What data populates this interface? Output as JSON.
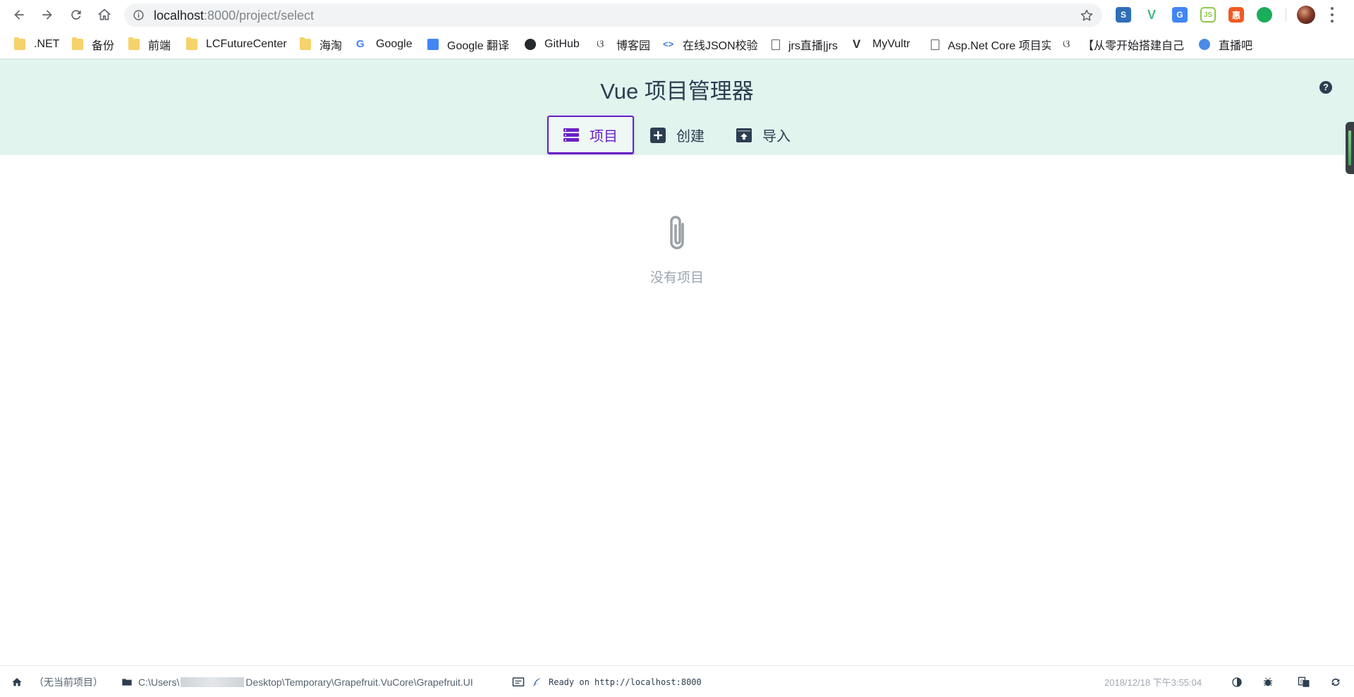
{
  "browser": {
    "url_host": "localhost",
    "url_path": ":8000/project/select",
    "bookmarks": [
      {
        "label": ".NET",
        "icon": "folder-icon"
      },
      {
        "label": "备份",
        "icon": "folder-icon"
      },
      {
        "label": "前端",
        "icon": "folder-icon"
      },
      {
        "label": "LCFutureCenter",
        "icon": "folder-icon"
      },
      {
        "label": "海淘",
        "icon": "folder-icon"
      },
      {
        "label": "Google",
        "icon": "google-icon"
      },
      {
        "label": "Google 翻译",
        "icon": "translate-icon"
      },
      {
        "label": "GitHub",
        "icon": "github-icon"
      },
      {
        "label": "博客园",
        "icon": "cnblogs-icon"
      },
      {
        "label": "在线JSON校验",
        "icon": "json-icon"
      },
      {
        "label": "jrs直播|jrs",
        "icon": "page-icon"
      },
      {
        "label": "MyVultr",
        "icon": "vultr-icon"
      },
      {
        "label": "Asp.Net Core 项目实",
        "icon": "page-icon"
      },
      {
        "label": "【从零开始搭建自己的",
        "icon": "cnblogs-icon"
      },
      {
        "label": "直播吧",
        "icon": "zhibo8-icon"
      }
    ]
  },
  "app": {
    "title": "Vue 项目管理器",
    "help": "?",
    "tabs": [
      {
        "label": "项目",
        "selected": true
      },
      {
        "label": "创建",
        "selected": false
      },
      {
        "label": "导入",
        "selected": false
      }
    ],
    "empty_message": "没有项目",
    "accent_color": "#6a1fc6",
    "header_bg": "#e1f4ee"
  },
  "statusbar": {
    "current_project": "（无当前项目）",
    "path_prefix": "C:\\Users\\",
    "path_suffix": "Desktop\\Temporary\\Grapefruit.VuCore\\Grapefruit.UI",
    "log": "Ready on http://localhost:8000",
    "datetime": "2018/12/18 下午3:55:04"
  }
}
